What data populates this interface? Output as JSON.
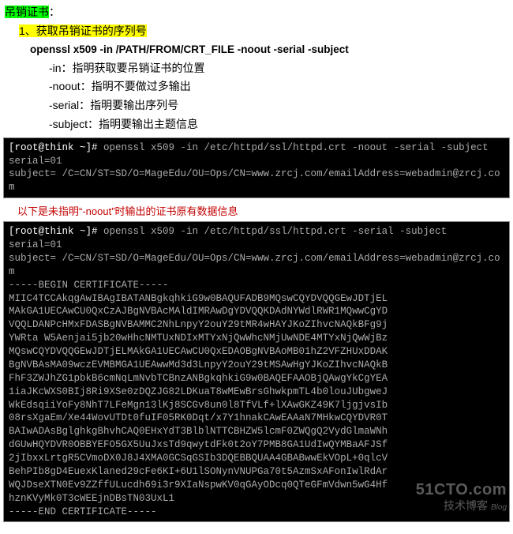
{
  "header": {
    "title_a": "吊销证书",
    "title_b": "：",
    "step": "1、获取吊销证书的序列号"
  },
  "command": "openssl x509 -in /PATH/FROM/CRT_FILE -noout -serial -subject",
  "options": {
    "in": "-in：指明获取要吊销证书的位置",
    "noout": "-noout：指明不要做过多输出",
    "serial": "-serial：指明要输出序列号",
    "subject": "-subject：指明要输出主题信息"
  },
  "terminal1": {
    "prompt": "[root@think ~]# ",
    "cmd": "openssl x509 -in /etc/httpd/ssl/httpd.crt -noout -serial -subject",
    "out": "serial=01\nsubject= /C=CN/ST=SD/O=MageEdu/OU=Ops/CN=www.zrcj.com/emailAddress=webadmin@zrcj.com"
  },
  "note": "以下是未指明“-noout”时输出的证书原有数据信息",
  "terminal2": {
    "prompt": "[root@think ~]# ",
    "cmd": "openssl x509 -in /etc/httpd/ssl/httpd.crt -serial -subject",
    "out": "serial=01\nsubject= /C=CN/ST=SD/O=MageEdu/OU=Ops/CN=www.zrcj.com/emailAddress=webadmin@zrcj.com\n-----BEGIN CERTIFICATE-----\nMIIC4TCCAkqgAwIBAgIBATANBgkqhkiG9w0BAQUFADB9MQswCQYDVQQGEwJDTjEL\nMAkGA1UECAwCU0QxCzAJBgNVBAcMAldIMRAwDgYDVQQKDAdNYWdlRWR1MQwwCgYD\nVQQLDANPcHMxFDASBgNVBAMMC2NhLnpyY2ouY29tMR4wHAYJKoZIhvcNAQkBFg9j\nYWRta W5Aenjai5jb20wHhcNMTUxNDIxMTYxNjQwWhcNMjUwNDE4MTYxNjQwWjBz\nMQswCQYDVQQGEwJDTjELMAkGA1UECAwCU0QxEDAOBgNVBAoMB01hZ2VFZHUxDDAK\nBgNVBAsMA09wczEVMBMGA1UEAwwMd3d3LnpyY2ouY29tMSAwHgYJKoZIhvcNAQkB\nFhF3ZWJhZG1pbkB6cmNqLmNvbTCBnzANBgkqhkiG9w0BAQEFAAOBjQAwgYkCgYEA\n1iaJKcWXS0BIj8Ri9XSe0zDQZJG82LDKuaT8wMEwBrsGhwkpmTL4b0louJUbgweJ\nWkEdsqiiYoFy8NhT7LFeMgn13lKj8SCGv8un0l8TfVLf+lXAwGKZ49K7ljgjvsIb\n08rsXgaEm/Xe44WovUTDt0fuIF05RK0Dqt/x7Y1hnakCAwEAAaN7MHkwCQYDVR0T\nBAIwADAsBglghkgBhvhCAQ0EHxYdT3BlblNTTCBHZW5lcmF0ZWQgQ2VydGlmaWNh\ndGUwHQYDVR0OBBYEFO5GX5UuJxsTd9qwytdFk0t2oY7PMB8GA1UdIwQYMBaAFJSf\n2jIbxxLrtgR5CVmoDX0J8J4XMA0GCSqGSIb3DQEBBQUAA4GBABwwEkVOpL+0qlcV\nBehPIb8gD4EuexKlaned29cFe6KI+6U1lSONynVNUPGa70t5AzmSxAFonIwlRdAr\nWQJDseXTN0Ev9ZZffULucdh69i3r9XIaNspwKV0qGAyODcq0QTeGFmVdwn5wG4Hf\nhznKVyMk0T3cWEEjnDBsTN03UxL1\n-----END CERTIFICATE-----"
  },
  "watermark": {
    "line1": "51CTO.com",
    "line2": "技术博客",
    "tag": "Blog"
  }
}
